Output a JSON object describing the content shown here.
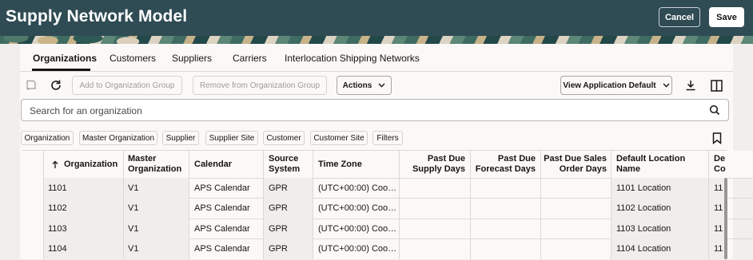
{
  "header": {
    "title": "Supply Network Model",
    "cancel_label": "Cancel",
    "save_label": "Save"
  },
  "tabs": [
    {
      "label": "Organizations",
      "active": true
    },
    {
      "label": "Customers"
    },
    {
      "label": "Suppliers"
    },
    {
      "label": "Carriers"
    },
    {
      "label": "Interlocation Shipping Networks"
    }
  ],
  "toolbar": {
    "add_group_label": "Add to Organization Group",
    "remove_group_label": "Remove from Organization Group",
    "actions_label": "Actions",
    "view_label": "View Application Default"
  },
  "search": {
    "placeholder": "Search for an organization"
  },
  "filter_chips": [
    "Organization",
    "Master Organization",
    "Supplier",
    "Supplier Site",
    "Customer",
    "Customer Site",
    "Filters"
  ],
  "table": {
    "columns": [
      "Organization",
      "Master Organization",
      "Calendar",
      "Source System",
      "Time Zone",
      "Past Due Supply Days",
      "Past Due Forecast Days",
      "Past Due Sales Order Days",
      "Default Location Name",
      "De Co"
    ],
    "rows": [
      [
        "1101",
        "V1",
        "APS Calendar",
        "GPR",
        "(UTC+00:00) Coo…",
        "",
        "",
        "",
        "1101 Location",
        "11"
      ],
      [
        "1102",
        "V1",
        "APS Calendar",
        "GPR",
        "(UTC+00:00) Coo…",
        "",
        "",
        "",
        "1102 Location",
        "11"
      ],
      [
        "1103",
        "V1",
        "APS Calendar",
        "GPR",
        "(UTC+00:00) Coo…",
        "",
        "",
        "",
        "1103 Location",
        "11"
      ],
      [
        "1104",
        "V1",
        "APS Calendar",
        "GPR",
        "(UTC+00:00) Coo…",
        "",
        "",
        "",
        "1104 Location",
        "11"
      ]
    ]
  },
  "colors": {
    "header_bg": "#2f4b53",
    "panel_bg": "#fbf9f8",
    "page_bg": "#f1efed"
  }
}
